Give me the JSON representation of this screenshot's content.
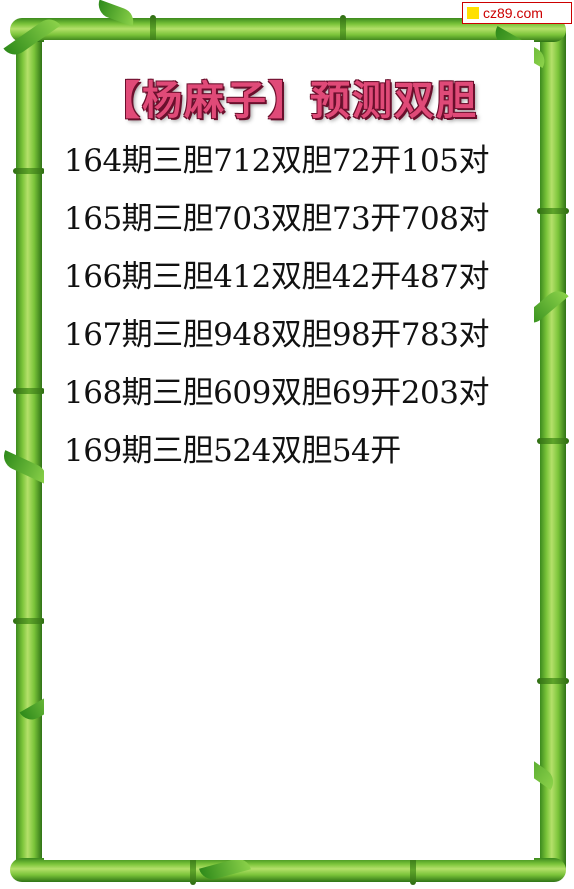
{
  "watermark": {
    "text": "cz89.com",
    "color": "#cc0000",
    "square_color": "#ffe000"
  },
  "title": "【杨麻子】预测双胆",
  "rows": [
    "164期三胆712双胆72开105对",
    "165期三胆703双胆73开708对",
    "166期三胆412双胆42开487对",
    "167期三胆948双胆98开783对",
    "168期三胆609双胆69开203对",
    "169期三胆524双胆54开"
  ],
  "colors": {
    "title": "#e04a78",
    "bamboo": "#7bc43a",
    "text": "#111111"
  }
}
